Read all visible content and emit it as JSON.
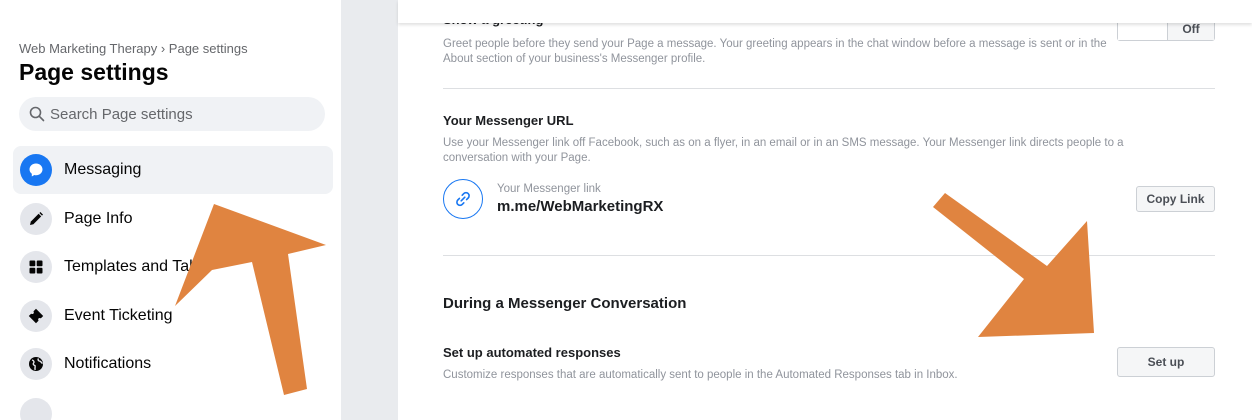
{
  "sidebar": {
    "breadcrumb": "Web Marketing Therapy › Page settings",
    "title": "Page settings",
    "search_placeholder": "Search Page settings",
    "items": [
      {
        "label": "Messaging",
        "icon": "messenger-icon",
        "active": true
      },
      {
        "label": "Page Info",
        "icon": "pencil-icon"
      },
      {
        "label": "Templates and Tabs",
        "icon": "grid-icon"
      },
      {
        "label": "Event Ticketing",
        "icon": "ticket-icon"
      },
      {
        "label": "Notifications",
        "icon": "globe-icon"
      }
    ]
  },
  "main": {
    "greeting": {
      "title": "Show a greeting",
      "description": "Greet people before they send your Page a message. Your greeting appears in the chat window before a message is sent or in the About section of your business's Messenger profile.",
      "toggle_label": "Off"
    },
    "messenger_url": {
      "title": "Your Messenger URL",
      "description": "Use your Messenger link off Facebook, such as on a flyer, in an email or in an SMS message. Your Messenger link directs people to a conversation with your Page.",
      "link_caption": "Your Messenger link",
      "link_value": "m.me/WebMarketingRX",
      "copy_button": "Copy Link"
    },
    "conversation": {
      "title": "During a Messenger Conversation",
      "automated_title": "Set up automated responses",
      "automated_description": "Customize responses that are automatically sent to people in the Automated Responses tab in Inbox.",
      "setup_button": "Set up"
    }
  },
  "colors": {
    "accent": "#1877f2",
    "annotation_arrow": "#e08440",
    "gutter": "#e9ebee"
  }
}
